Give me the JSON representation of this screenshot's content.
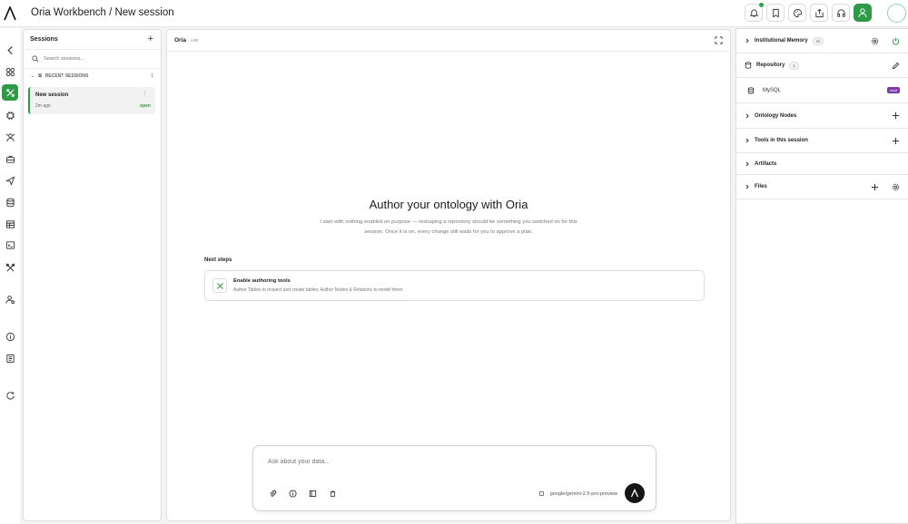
{
  "app": {
    "title": "Oria Workbench / New session"
  },
  "rail": {
    "items": [
      "back-icon",
      "overview-icon",
      "workbench-icon",
      "chip-icon",
      "agents-icon",
      "toolbox-icon",
      "send-icon",
      "database-icon",
      "table-icon",
      "terminal-icon",
      "tools-icon",
      "user-settings-icon",
      "info-icon",
      "docs-icon",
      "refresh-icon"
    ]
  },
  "sessions": {
    "title": "Sessions",
    "search_placeholder": "Search sessions...",
    "group_label": "RECENT SESSIONS",
    "group_count": "1",
    "items": [
      {
        "name": "New session",
        "time": "2m ago",
        "state": "open"
      }
    ]
  },
  "chat": {
    "agent": "Oria",
    "version": "v.90",
    "hero_title": "Author your ontology with Oria",
    "hero_desc": "I start with nothing enabled on purpose — reshaping a repository should be something you switched on for this session. Once it is on, every change still waits for you to approve a plan.",
    "next_steps_title": "Next steps",
    "next_steps": [
      {
        "name": "Enable authoring tools",
        "desc": "Author Tables to inspect and create tables; Author Nodes & Relations to model them."
      }
    ],
    "composer_placeholder": "Ask about your data...",
    "model": "google/gemini-2.5-pro-preview"
  },
  "right_panel": {
    "institutional_memory": {
      "label": "Institutional Memory",
      "badge": "1k"
    },
    "repository": {
      "label": "Repository",
      "badge": "1",
      "db_name": "MySQL",
      "db_chip": "read"
    },
    "ontology_nodes": {
      "label": "Ontology Nodes"
    },
    "tools": {
      "label": "Tools in this session"
    },
    "artifacts": {
      "label": "Artifacts"
    },
    "files": {
      "label": "Files"
    }
  },
  "colors": {
    "accent": "#2f9a45",
    "chip": "#7c3aad",
    "send": "#151515"
  }
}
